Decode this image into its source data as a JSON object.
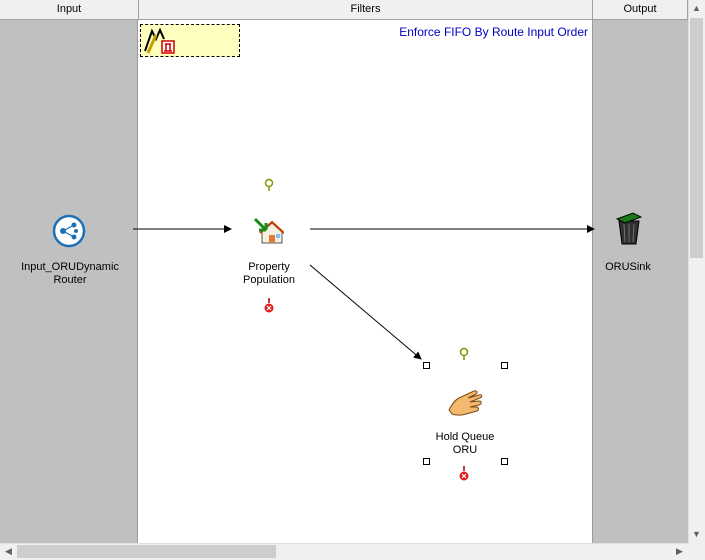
{
  "columns": {
    "input": "Input",
    "filters": "Filters",
    "output": "Output"
  },
  "annotation": {
    "text": "Enforce FIFO By Route Input Order",
    "icon": "note-icon"
  },
  "nodes": {
    "input_node": {
      "label": "Input_ORUDynamic\nRouter",
      "icon": "router-icon"
    },
    "property_population": {
      "label": "Property\nPopulation",
      "icon": "property-population-icon"
    },
    "hold_queue": {
      "label": "Hold Queue\nORU",
      "icon": "hand-icon"
    },
    "sink": {
      "label": "ORUSink",
      "icon": "trash-bin-icon"
    }
  },
  "colors": {
    "side_column": "#c0c0c0",
    "canvas": "#ffffff",
    "annotation_text": "#0000c0",
    "annotation_fill": "#ffffc0"
  },
  "scrollbars": {
    "up": "▲",
    "down": "▼",
    "left": "◀",
    "right": "▶"
  }
}
